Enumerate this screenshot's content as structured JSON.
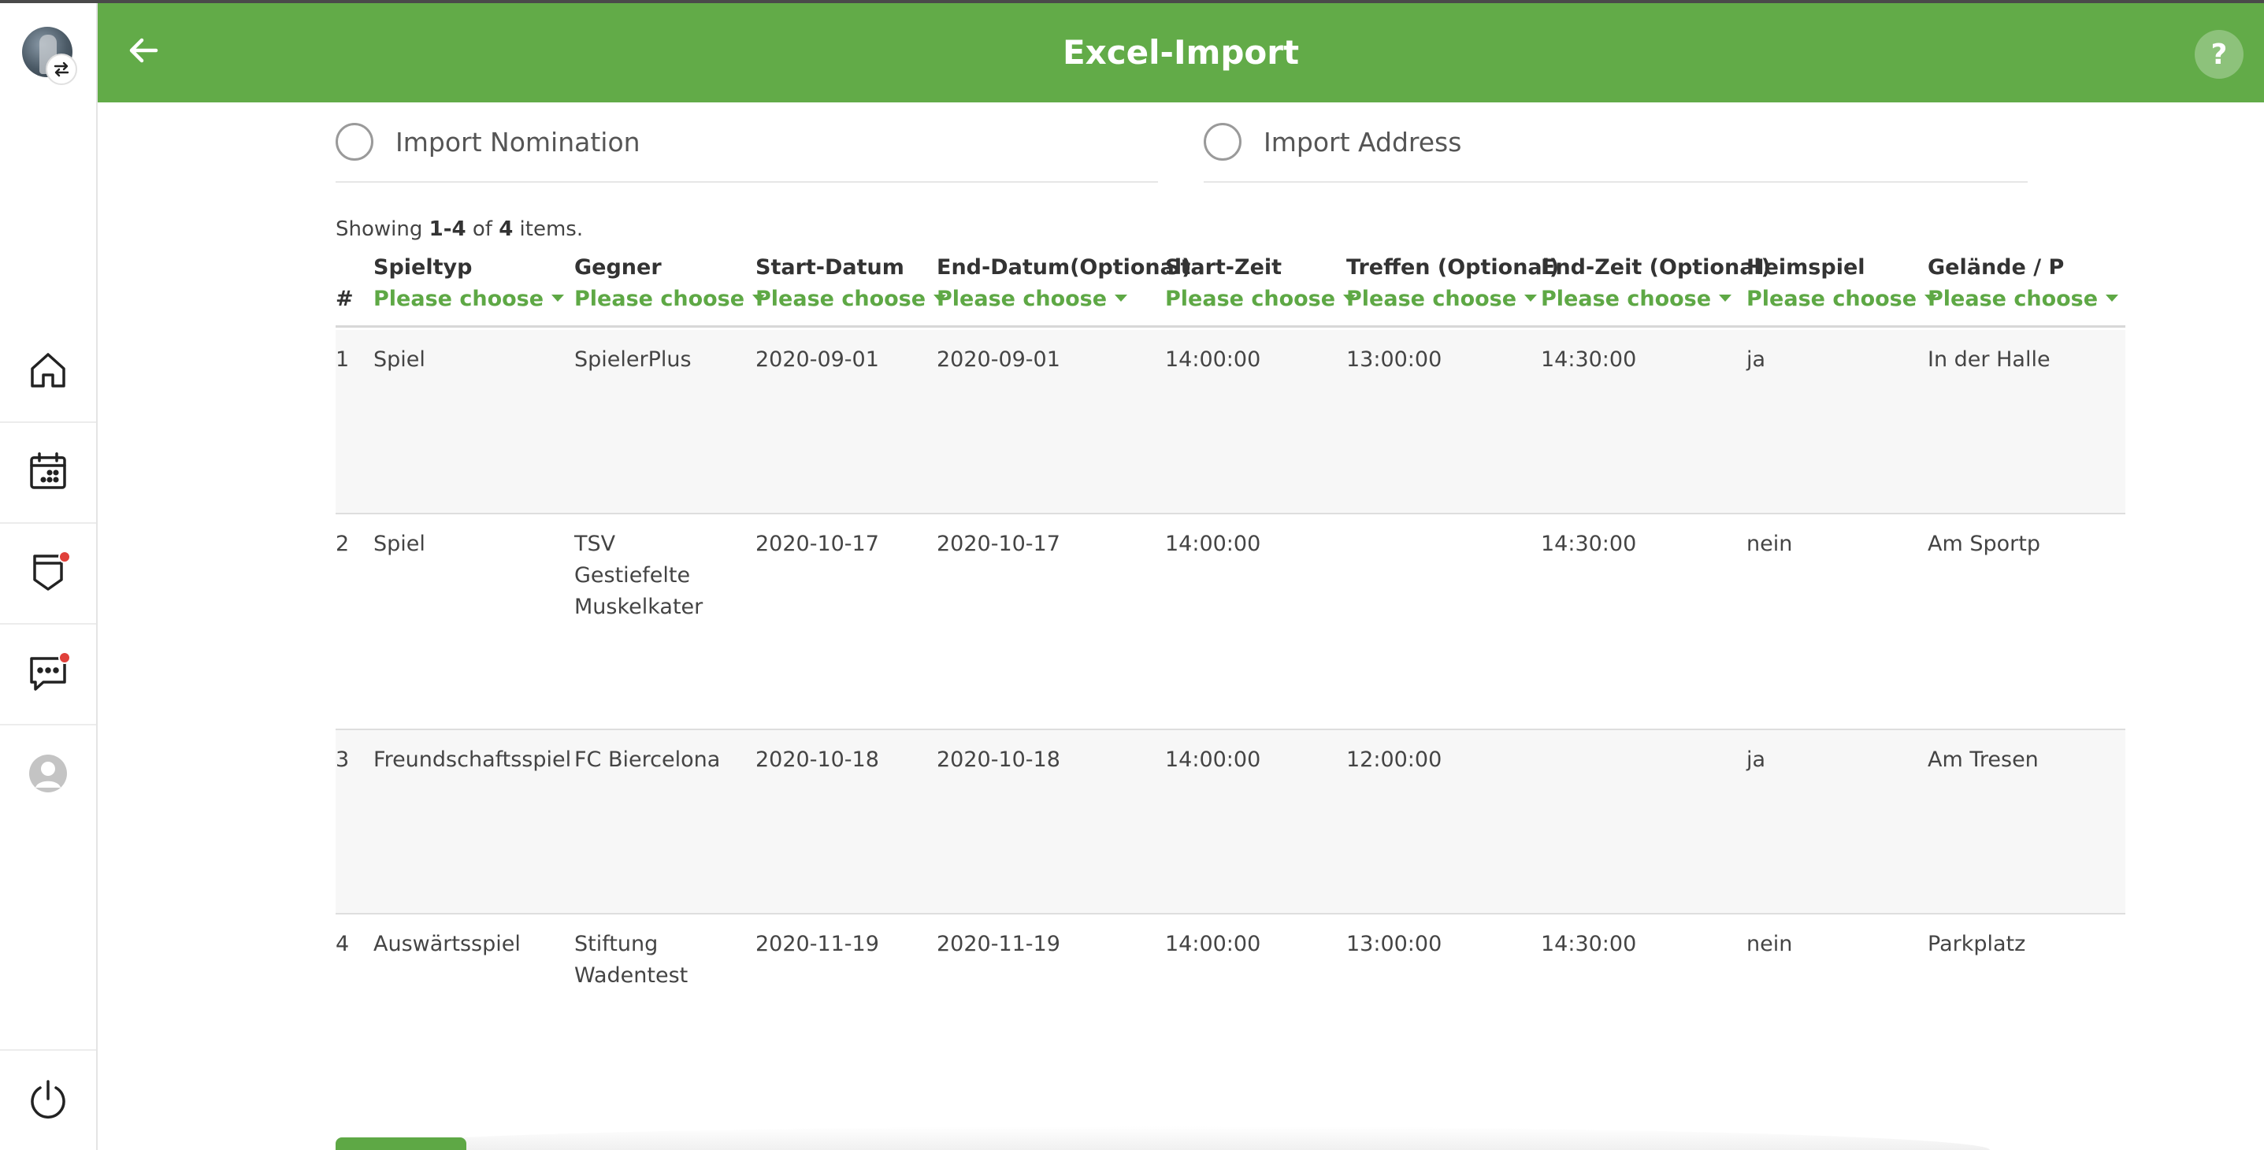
{
  "app": {
    "title": "Excel-Import",
    "help_label": "?"
  },
  "colors": {
    "brand_green": "#62ab48",
    "filter_green": "#5ea845",
    "notification_red": "#e0403a"
  },
  "sidebar": {
    "items": [
      {
        "name": "home",
        "icon": "home-icon",
        "badge": false
      },
      {
        "name": "calendar",
        "icon": "calendar-icon",
        "badge": false
      },
      {
        "name": "notes",
        "icon": "tag-icon",
        "badge": true
      },
      {
        "name": "chat",
        "icon": "chat-icon",
        "badge": true
      },
      {
        "name": "profile",
        "icon": "user-icon",
        "badge": false
      }
    ],
    "logout_icon": "power-icon"
  },
  "options": {
    "nomination_label": "Import Nomination",
    "address_label": "Import Address"
  },
  "summary": {
    "prefix": "Showing ",
    "range": "1-4",
    "of": " of ",
    "total": "4",
    "suffix": " items."
  },
  "table": {
    "filter_label": "Please choose",
    "hash_label": "#",
    "columns": [
      "Spieltyp",
      "Gegner",
      "Start-Datum",
      "End-Datum(Optional)",
      "Start-Zeit",
      "Treffen (Optional)",
      "End-Zeit (Optional)",
      "Heimspiel",
      "Gelände / P"
    ],
    "rows": [
      {
        "num": "1",
        "cells": [
          "Spiel",
          "SpielerPlus",
          "2020-09-01",
          "2020-09-01",
          "14:00:00",
          "13:00:00",
          "14:30:00",
          "ja",
          "In der Halle"
        ]
      },
      {
        "num": "2",
        "cells": [
          "Spiel",
          "TSV Gestiefelte Muskelkater",
          "2020-10-17",
          "2020-10-17",
          "14:00:00",
          "",
          "14:30:00",
          "nein",
          "Am Sportp"
        ]
      },
      {
        "num": "3",
        "cells": [
          "Freundschaftsspiel",
          "FC Biercelona",
          "2020-10-18",
          "2020-10-18",
          "14:00:00",
          "12:00:00",
          "",
          "ja",
          "Am Tresen"
        ]
      },
      {
        "num": "4",
        "cells": [
          "Auswärtsspiel",
          "Stiftung Wadentest",
          "2020-11-19",
          "2020-11-19",
          "14:00:00",
          "13:00:00",
          "14:30:00",
          "nein",
          "Parkplatz"
        ]
      }
    ]
  }
}
